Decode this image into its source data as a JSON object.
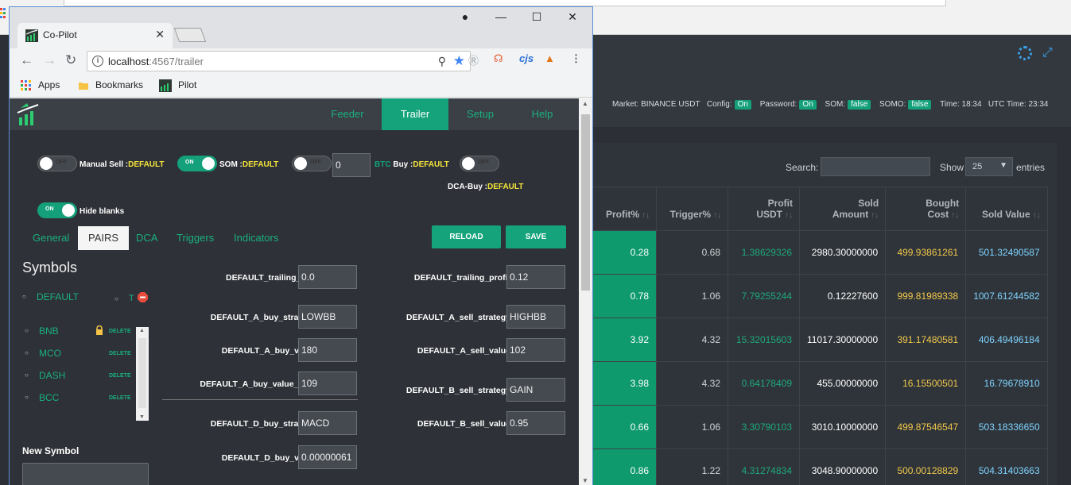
{
  "background": {
    "status": {
      "market_label": "Market:",
      "market_value": "BINANCE USDT",
      "config_label": "Config:",
      "config_value": "On",
      "password_label": "Password:",
      "password_value": "On",
      "som_label": "SOM:",
      "som_value": "false",
      "somo_label": "SOMO:",
      "somo_value": "false",
      "time_label": "Time:",
      "time_value": "18:34",
      "utc_label": "UTC Time:",
      "utc_value": "23:34"
    },
    "search_label": "Search:",
    "show_label": "Show",
    "show_value": "25",
    "entries_label": "entries",
    "table": {
      "headers": [
        {
          "l1": "",
          "l2": "Profit%"
        },
        {
          "l1": "",
          "l2": "Trigger%"
        },
        {
          "l1": "Profit",
          "l2": "USDT"
        },
        {
          "l1": "Sold",
          "l2": "Amount"
        },
        {
          "l1": "Bought",
          "l2": "Cost"
        },
        {
          "l1": "",
          "l2": "Sold Value"
        }
      ],
      "rows": [
        [
          "0.28",
          "0.68",
          "1.38629326",
          "2980.30000000",
          "499.93861261",
          "501.32490587"
        ],
        [
          "0.78",
          "1.06",
          "7.79255244",
          "0.12227600",
          "999.81989338",
          "1007.61244582"
        ],
        [
          "3.92",
          "4.32",
          "15.32015603",
          "11017.30000000",
          "391.17480581",
          "406.49496184"
        ],
        [
          "3.98",
          "4.32",
          "0.64178409",
          "455.00000000",
          "16.15500501",
          "16.79678910"
        ],
        [
          "0.66",
          "1.06",
          "3.30790103",
          "3010.10000000",
          "499.87546547",
          "503.18336650"
        ],
        [
          "0.86",
          "1.22",
          "4.31274834",
          "3048.90000000",
          "500.00128829",
          "504.31403663"
        ]
      ]
    }
  },
  "browser": {
    "tab_title": "Co-Pilot",
    "url_host": "localhost",
    "url_rest": ":4567/trailer",
    "ext_cjs": "cjs",
    "bookmarks": [
      {
        "label": "Apps",
        "icon": "apps-grid-icon"
      },
      {
        "label": "Bookmarks",
        "icon": "folder-icon"
      },
      {
        "label": "Pilot",
        "icon": "pilot-logo-icon"
      }
    ]
  },
  "app": {
    "nav": [
      "Feeder",
      "Trailer",
      "Setup",
      "Help"
    ],
    "active_nav": "Trailer",
    "toggles": {
      "manual_sell": {
        "state": "OFF",
        "label": "Manual Sell :",
        "default": "DEFAULT"
      },
      "som": {
        "state": "ON",
        "label": "SOM :",
        "default": "DEFAULT"
      },
      "buy": {
        "state": "OFF",
        "input": "0",
        "btc": "BTC",
        "label": " Buy :",
        "default": "DEFAULT"
      },
      "dca_buy": {
        "state": "OFF",
        "label": "DCA-Buy :",
        "default": "DEFAULT"
      },
      "hide_blanks": {
        "state": "ON",
        "label": "Hide blanks"
      }
    },
    "subtabs": [
      "General",
      "PAIRS",
      "DCA",
      "Triggers",
      "Indicators"
    ],
    "reload_label": "RELOAD",
    "save_label": "SAVE",
    "symbols_title": "Symbols",
    "default_symbol": "DEFAULT",
    "default_symbol_mark": "T",
    "symbols": [
      {
        "name": "BNB",
        "delete": "DELETE"
      },
      {
        "name": "MCO",
        "delete": "DELETE"
      },
      {
        "name": "DASH",
        "delete": "DELETE"
      },
      {
        "name": "BCC",
        "delete": "DELETE"
      }
    ],
    "new_symbol_label": "New Symbol",
    "new_symbol_value": "",
    "fields_left": [
      {
        "label": "DEFAULT_trailing_buy",
        "value": "0.0"
      },
      {
        "label": "DEFAULT_A_buy_strategy",
        "value": "LOWBB"
      },
      {
        "label": "DEFAULT_A_buy_value",
        "value": "180"
      },
      {
        "label": "DEFAULT_A_buy_value_limit",
        "value": "109"
      },
      {
        "label": "DEFAULT_D_buy_strategy",
        "value": "MACD"
      },
      {
        "label": "DEFAULT_D_buy_value",
        "value": "0.00000061"
      }
    ],
    "fields_right": [
      {
        "label": "DEFAULT_trailing_profit",
        "value": "0.12"
      },
      {
        "label": "DEFAULT_A_sell_strategy",
        "value": "HIGHBB"
      },
      {
        "label": "DEFAULT_A_sell_value",
        "value": "102"
      },
      {
        "label": "DEFAULT_B_sell_strategy",
        "value": "GAIN"
      },
      {
        "label": "DEFAULT_B_sell_value",
        "value": "0.95"
      }
    ]
  },
  "colors": {
    "accent": "#14a37a",
    "default_text": "#f5e53a",
    "page_bg": "#2e3137"
  }
}
